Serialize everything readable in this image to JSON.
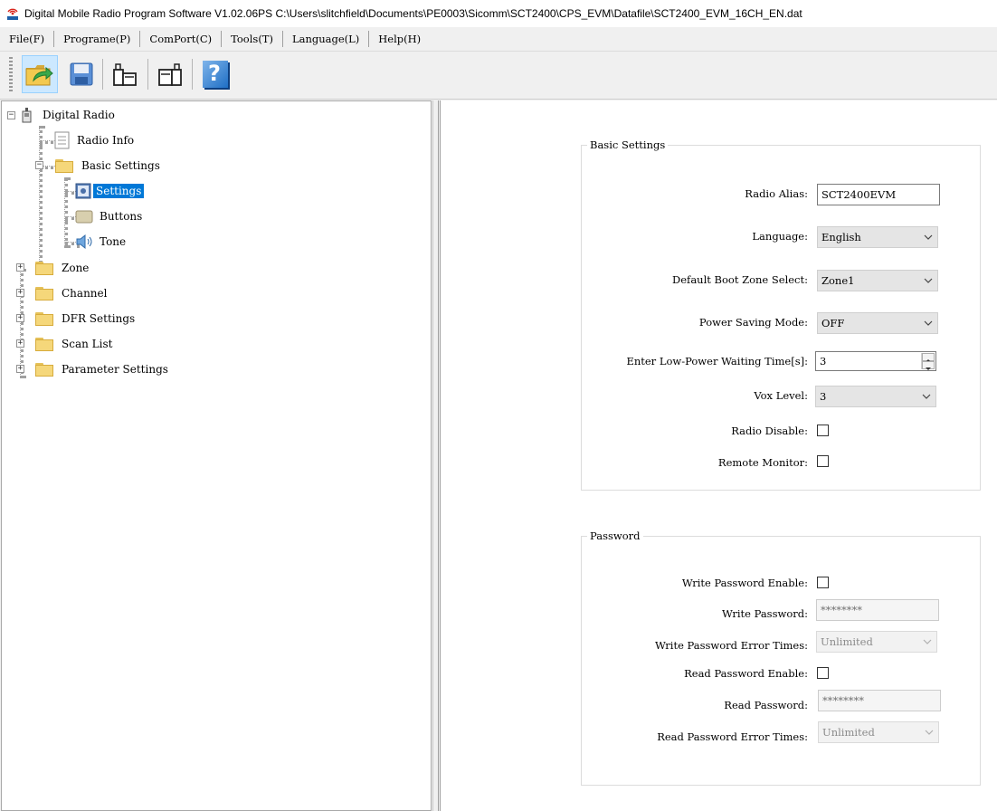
{
  "window": {
    "title": "Digital Mobile Radio Program Software V1.02.06PS C:\\Users\\slitchfield\\Documents\\PE0003\\Sicomm\\SCT2400\\CPS_EVM\\Datafile\\SCT2400_EVM_16CH_EN.dat"
  },
  "menu": {
    "items": [
      {
        "label": "File(F)"
      },
      {
        "label": "Programe(P)"
      },
      {
        "label": "ComPort(C)"
      },
      {
        "label": "Tools(T)"
      },
      {
        "label": "Language(L)"
      },
      {
        "label": "Help(H)"
      }
    ]
  },
  "toolbar": {
    "buttons": [
      {
        "icon": "open-folder-icon"
      },
      {
        "icon": "save-icon"
      },
      {
        "icon": "read-radio-icon"
      },
      {
        "icon": "write-radio-icon"
      },
      {
        "icon": "help-icon",
        "glyph": "?"
      }
    ]
  },
  "tree": {
    "root": "Digital Radio",
    "radio_info": "Radio Info",
    "basic_settings": "Basic Settings",
    "settings": "Settings",
    "buttons": "Buttons",
    "tone": "Tone",
    "zone": "Zone",
    "channel": "Channel",
    "dfr_settings": "DFR Settings",
    "scan_list": "Scan List",
    "parameter_settings": "Parameter Settings",
    "collapse_glyph": "−",
    "expand_glyph": "+"
  },
  "basic": {
    "title": "Basic Settings",
    "radio_alias_label": "Radio Alias:",
    "radio_alias_value": "SCT2400EVM",
    "language_label": "Language:",
    "language_value": "English",
    "boot_zone_label": "Default Boot Zone Select:",
    "boot_zone_value": "Zone1",
    "power_saving_label": "Power Saving Mode:",
    "power_saving_value": "OFF",
    "low_power_label": "Enter Low-Power Waiting Time[s]:",
    "low_power_value": "3",
    "vox_label": "Vox Level:",
    "vox_value": "3",
    "radio_disable_label": "Radio Disable:",
    "radio_disable_checked": false,
    "remote_monitor_label": "Remote Monitor:",
    "remote_monitor_checked": false
  },
  "password": {
    "title": "Password",
    "write_enable_label": "Write Password Enable:",
    "write_password_label": "Write Password:",
    "write_password_value": "********",
    "write_error_label": "Write Password Error Times:",
    "write_error_value": "Unlimited",
    "read_enable_label": "Read Password Enable:",
    "read_password_label": "Read Password:",
    "read_password_value": "********",
    "read_error_label": "Read Password Error Times:",
    "read_error_value": "Unlimited"
  },
  "colors": {
    "selection": "#0078d7",
    "folder": "#f5d77a",
    "help_icon": "#1f6fc5"
  }
}
